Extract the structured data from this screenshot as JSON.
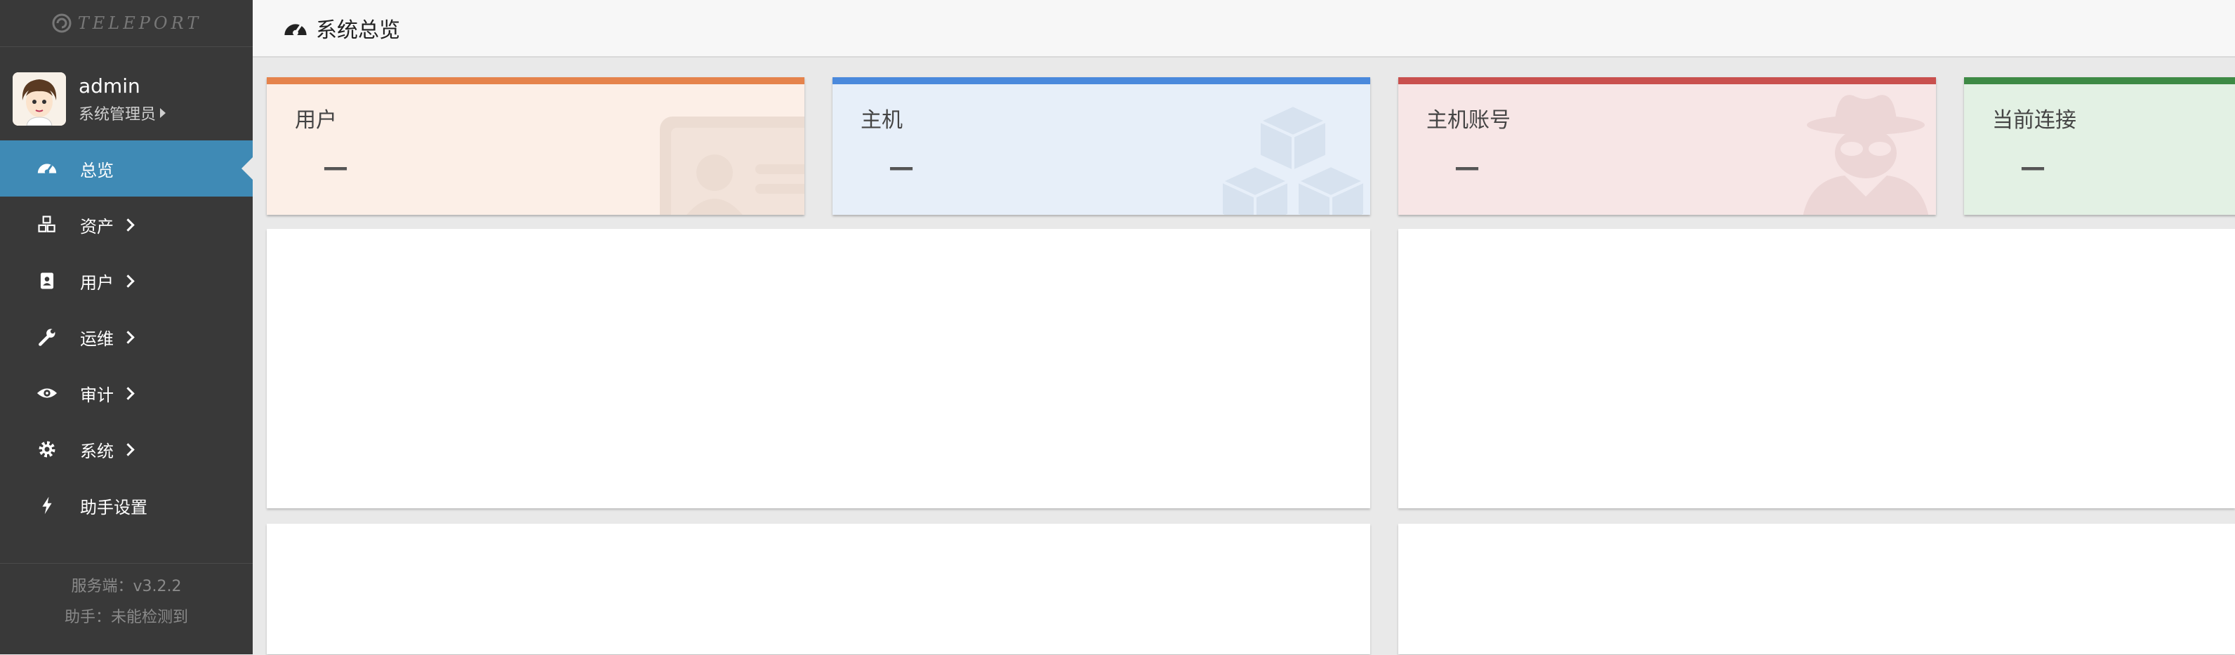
{
  "app": {
    "logo_text": "TELEPORT"
  },
  "profile": {
    "username": "admin",
    "role": "系统管理员"
  },
  "nav": {
    "items": [
      {
        "label": "总览",
        "icon": "dashboard-icon",
        "active": true
      },
      {
        "label": "资产",
        "icon": "cubes-icon",
        "submenu": true
      },
      {
        "label": "用户",
        "icon": "address-book-icon",
        "submenu": true
      },
      {
        "label": "运维",
        "icon": "wrench-icon",
        "submenu": true
      },
      {
        "label": "审计",
        "icon": "eye-icon",
        "submenu": true
      },
      {
        "label": "系统",
        "icon": "gear-icon",
        "submenu": true
      },
      {
        "label": "助手设置",
        "icon": "bolt-icon"
      }
    ]
  },
  "footer": {
    "server_version": "服务端：v3.2.2",
    "assistant_status": "助手：未能检测到"
  },
  "header": {
    "title": "系统总览",
    "icon": "dashboard-icon"
  },
  "cards": [
    {
      "label": "用户",
      "value": "—",
      "accent": "#e5834c",
      "bg": "#fcefe7",
      "icon": "id-card-icon"
    },
    {
      "label": "主机",
      "value": "—",
      "accent": "#4a89dc",
      "bg": "#e7eff9",
      "icon": "cubes-icon"
    },
    {
      "label": "主机账号",
      "value": "—",
      "accent": "#c9504e",
      "bg": "#f7e6e6",
      "icon": "user-secret-icon"
    },
    {
      "label": "当前连接",
      "value": "—",
      "accent": "#3e8a45",
      "bg": "#e3f1e4",
      "icon": "link-icon"
    }
  ]
}
